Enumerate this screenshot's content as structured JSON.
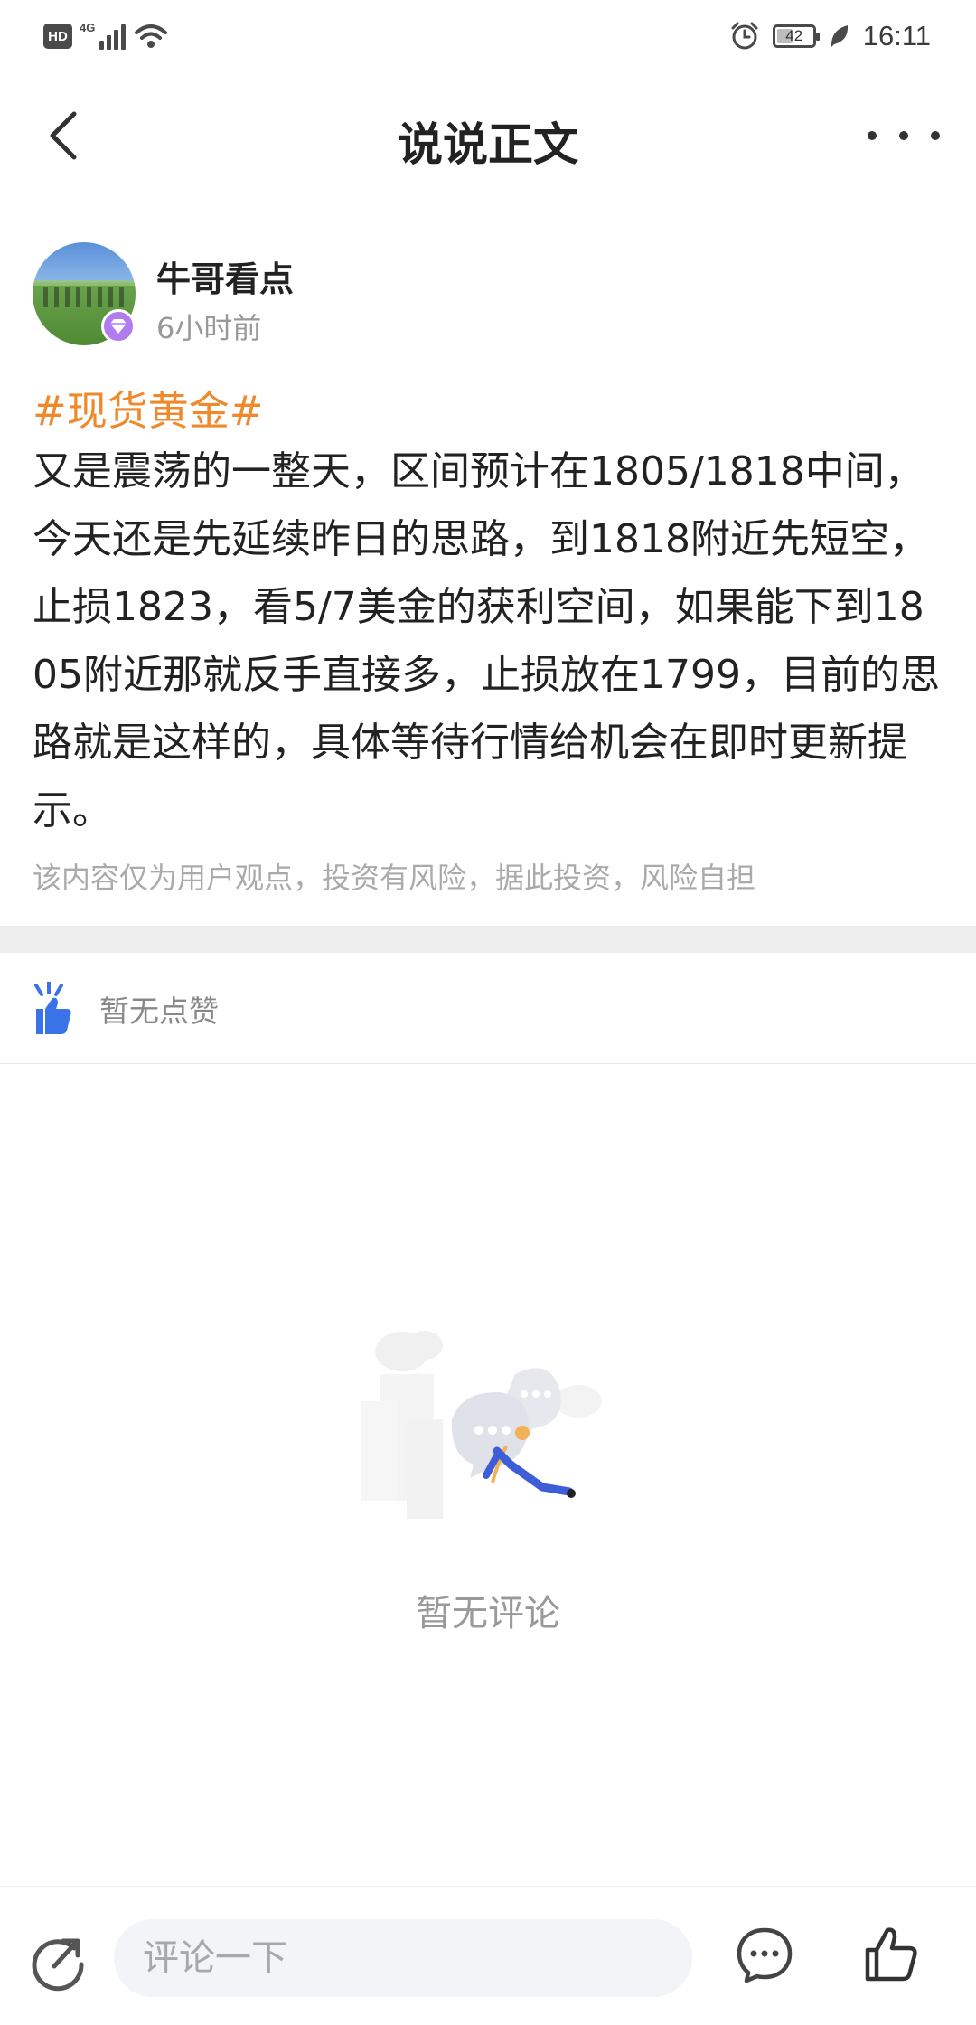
{
  "status_bar": {
    "hd_label": "HD",
    "network_label": "4G",
    "battery_level": "42",
    "time": "16:11"
  },
  "nav": {
    "title": "说说正文"
  },
  "author": {
    "name": "牛哥看点",
    "time_ago": "6小时前"
  },
  "post": {
    "hashtag": "#现货黄金#",
    "content": "又是震荡的一整天，区间预计在1805/1818中间，今天还是先延续昨日的思路，到1818附近先短空，止损1823，看5/7美金的获利空间，如果能下到1805附近那就反手直接多，止损放在1799，目前的思路就是这样的，具体等待行情给机会在即时更新提示。",
    "disclaimer": "该内容仅为用户观点，投资有风险，据此投资，风险自担"
  },
  "likes": {
    "empty_text": "暂无点赞"
  },
  "comments": {
    "empty_text": "暂无评论"
  },
  "bottom_bar": {
    "input_placeholder": "评论一下"
  },
  "colors": {
    "hashtag": "#ee8a2c",
    "accent_blue": "#3a72e8",
    "vip_purple": "#b07cf0"
  }
}
